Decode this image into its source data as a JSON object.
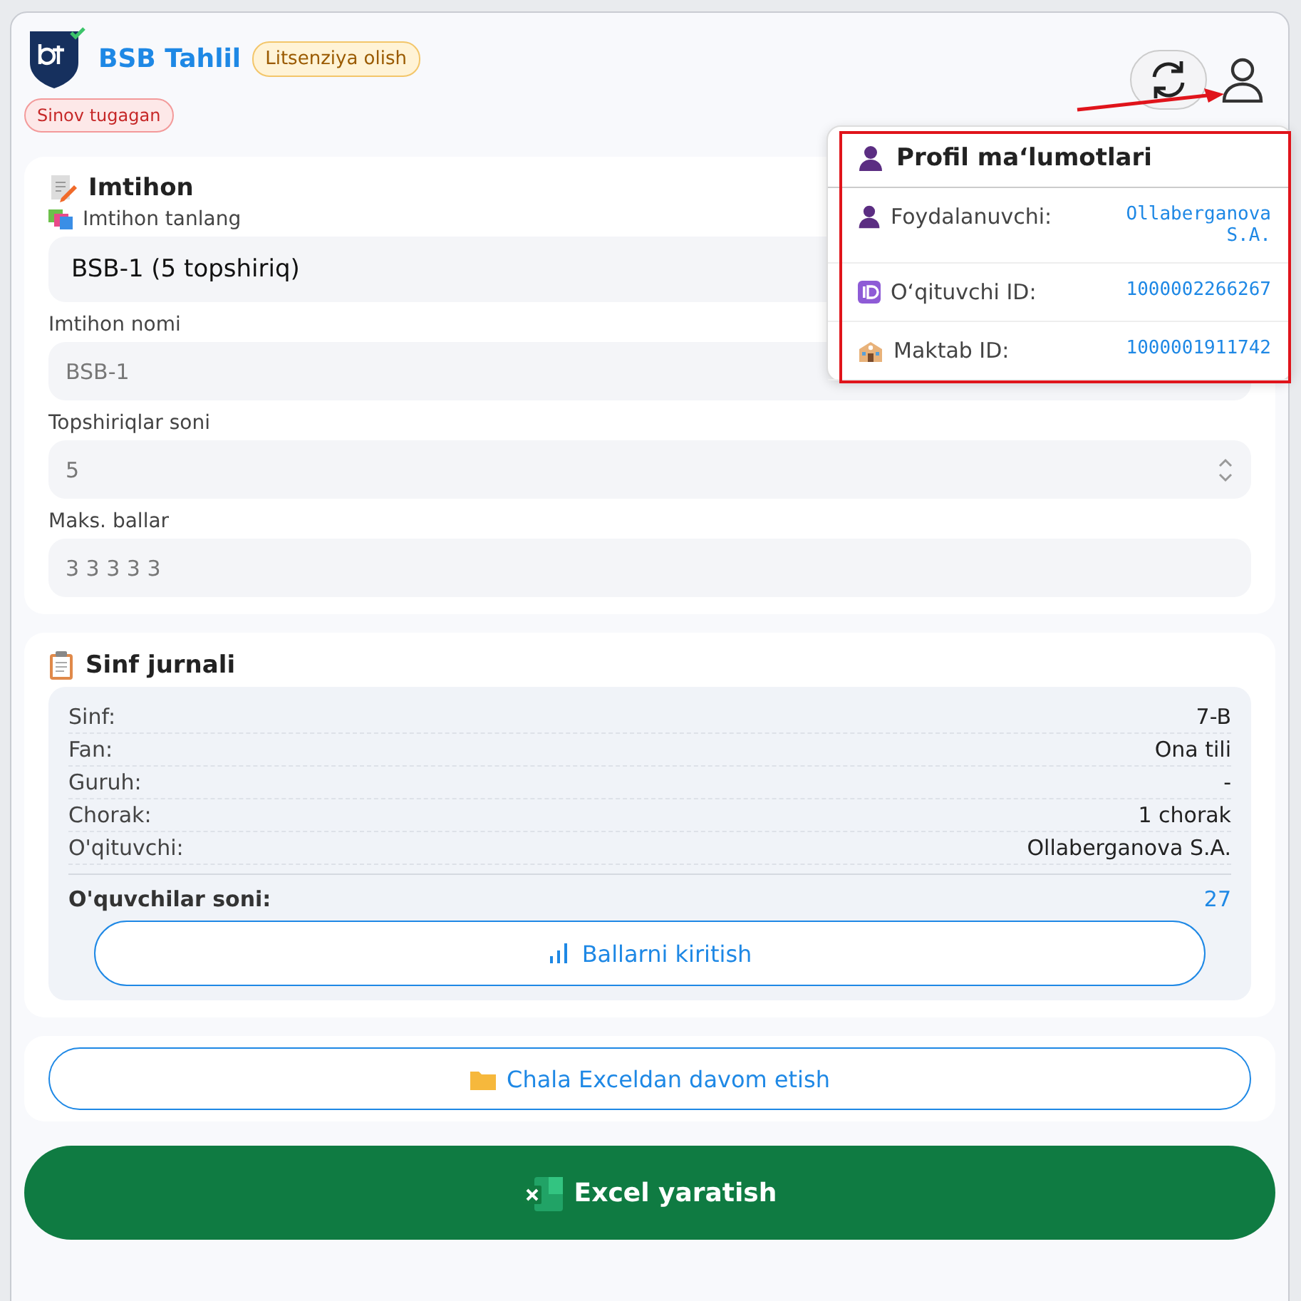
{
  "header": {
    "app_name": "BSB Tahlil",
    "license_badge": "Litsenziya olish",
    "trial_badge": "Sinov tugagan"
  },
  "exam": {
    "title": "Imtihon",
    "select_label": "Imtihon tanlang",
    "select_value": "BSB-1 (5 topshiriq)",
    "fields": [
      {
        "kind": "text",
        "label": "Imtihon nomi",
        "value": "BSB-1"
      },
      {
        "kind": "number",
        "label": "Topshiriqlar soni",
        "value": "5"
      },
      {
        "kind": "text",
        "label": "Maks. ballar",
        "value": "3 3 3 3 3"
      }
    ]
  },
  "journal": {
    "title": "Sinf jurnali",
    "rows": [
      {
        "label": "Sinf:",
        "value": "7-B"
      },
      {
        "label": "Fan:",
        "value": "Ona tili"
      },
      {
        "label": "Guruh:",
        "value": "-"
      },
      {
        "label": "Chorak:",
        "value": "1 chorak"
      },
      {
        "label": "O'qituvchi:",
        "value": "Ollaberganova S.A."
      }
    ],
    "students_label": "O'quvchilar soni:",
    "students_value": "27",
    "enter_button": "Ballarni kiritish"
  },
  "continue_button": "Chala Exceldan davom etish",
  "excel_button": "Excel yaratish",
  "profile_popup": {
    "title": "Profil maʻlumotlari",
    "rows": [
      {
        "kind": "user",
        "label": "Foydalanuvchi:",
        "value": "Ollaberganova S.A."
      },
      {
        "kind": "id",
        "label": "Oʻqituvchi ID:",
        "value": "1000002266267"
      },
      {
        "kind": "school",
        "label": "Maktab ID:",
        "value": "1000001911742"
      }
    ]
  }
}
